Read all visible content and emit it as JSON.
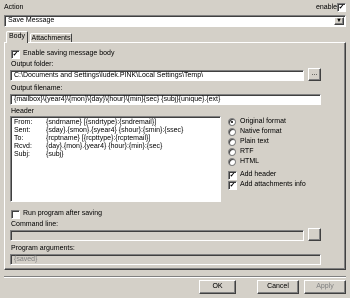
{
  "action": {
    "label": "Action",
    "selected": "Save Message",
    "enable_label": "enable",
    "enable_checked": true
  },
  "tabs": [
    "Body",
    "Attachments"
  ],
  "body": {
    "enable_saving_label": "Enable saving message body",
    "enable_saving_checked": true,
    "output_folder_label": "Output folder:",
    "output_folder_value": "C:\\Documents and Settings\\ludek.PINK\\Local Settings\\Temp\\",
    "browse_label": "...",
    "output_filename_label": "Output filename:",
    "output_filename_value": "{mailbox}\\{year4}\\{mon}\\{day}\\{hour}\\{min}{sec} {subj}{unique}.{ext}",
    "header_label": "Header",
    "header_rows": [
      {
        "key": "From:",
        "value": "{sndrname} [{sndrtype}:{sndremail}]"
      },
      {
        "key": "Sent:",
        "value": "{sday}.{smon}.{syear4} {shour}:{smin}:{ssec}"
      },
      {
        "key": "To:",
        "value": "{rcptname} [{rcpttype}:{rcptemail}]"
      },
      {
        "key": "Rcvd:",
        "value": "{day}.{mon}.{year4} {hour}:{min}:{sec}"
      },
      {
        "key": "Subj:",
        "value": "{subj}"
      }
    ],
    "formats": [
      {
        "label": "Original format",
        "selected": true
      },
      {
        "label": "Native format",
        "selected": false
      },
      {
        "label": "Plain text",
        "selected": false
      },
      {
        "label": "RTF",
        "selected": false
      },
      {
        "label": "HTML",
        "selected": false
      }
    ],
    "add_header_label": "Add header",
    "add_header_checked": true,
    "add_attachments_label": "Add attachments info",
    "add_attachments_checked": true,
    "run_program_label": "Run program after saving",
    "run_program_checked": false,
    "command_line_label": "Command line:",
    "command_line_value": "",
    "program_args_label": "Program arguments:",
    "program_args_value": "{saved}"
  },
  "buttons": {
    "ok": "OK",
    "cancel": "Cancel",
    "apply": "Apply"
  }
}
